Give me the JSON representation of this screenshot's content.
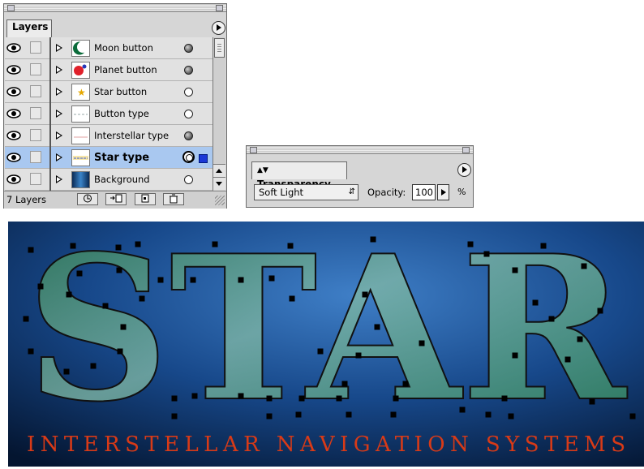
{
  "layers_panel": {
    "tab_label": "Layers",
    "layers": [
      {
        "name": "Moon button",
        "thumb": "moon",
        "target": "filled"
      },
      {
        "name": "Planet button",
        "thumb": "planet",
        "target": "filled"
      },
      {
        "name": "Star button",
        "thumb": "star",
        "target": "empty"
      },
      {
        "name": "Button type",
        "thumb": "lines",
        "target": "empty"
      },
      {
        "name": "Interstellar type",
        "thumb": "redline",
        "target": "filled"
      },
      {
        "name": "Star type",
        "thumb": "bluelines",
        "target": "selected",
        "selected": true
      },
      {
        "name": "Background",
        "thumb": "gradient",
        "target": "empty"
      }
    ],
    "layer_count": "7 Layers",
    "footer_buttons": [
      "new-sublayer",
      "new-layer",
      "move-selection",
      "trash"
    ]
  },
  "transparency_panel": {
    "tab_label": "Transparency",
    "blend_mode": "Soft Light",
    "opacity_label": "Opacity:",
    "opacity_value": "100",
    "percent_label": "%"
  },
  "artwork": {
    "title": "STAR",
    "subtitle": "INTERSTELLAR NAVIGATION SYSTEMS",
    "colors": {
      "background_center": "#3f7fc7",
      "background_edge": "#041530",
      "subtitle": "#d83a17",
      "letter_fill": "#5fa48f"
    }
  },
  "icons": {
    "eye": "eye-icon",
    "expand": "expand-triangle-icon",
    "menu": "palette-menu-icon"
  }
}
